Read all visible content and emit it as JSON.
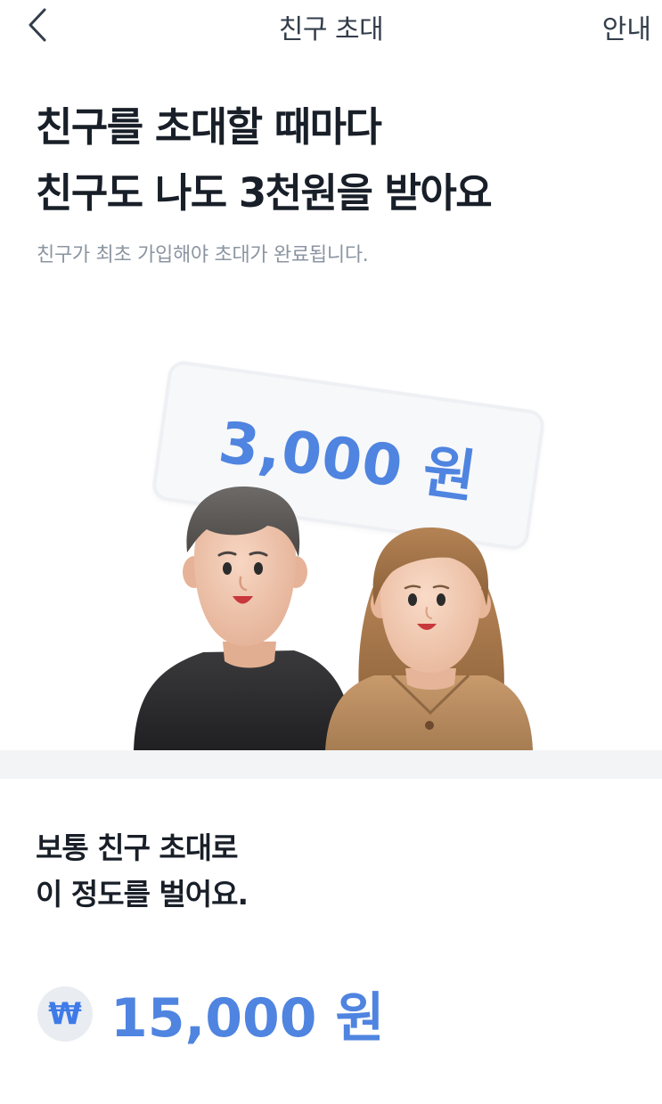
{
  "header": {
    "title": "친구 초대",
    "guide_label": "안내",
    "back_icon": "chevron-left-icon"
  },
  "headline": {
    "line1": "친구를 초대할 때마다",
    "line2": "친구도 나도 3천원을 받아요"
  },
  "subtext": "친구가 최초 가입해야 초대가 완료됩니다.",
  "reward_card": {
    "amount": "3,000 원"
  },
  "earnings": {
    "line1": "보통 친구 초대로",
    "line2": "이 정도를 벌어요.",
    "currency_symbol": "₩",
    "amount": "15,000 원"
  },
  "colors": {
    "accent": "#4f84e0",
    "text_primary": "#191f28",
    "text_secondary": "#8b95a1",
    "divider": "#f2f4f6"
  }
}
